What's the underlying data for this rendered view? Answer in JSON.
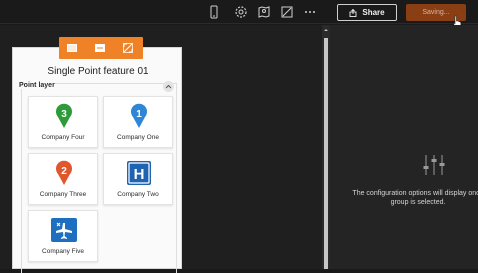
{
  "header": {
    "share_label": "Share",
    "saving_label": "Saving...",
    "icons": [
      "mobile-icon",
      "gear-icon",
      "map-settings-icon",
      "image-edit-icon",
      "more-icon"
    ]
  },
  "card": {
    "title": "Single Point feature 01",
    "section_label": "Point layer",
    "items": [
      {
        "label": "Company Four",
        "icon": "green-pin-3",
        "badge": "3",
        "color": "#2e9b3a"
      },
      {
        "label": "Company One",
        "icon": "blue-pin-1",
        "badge": "1",
        "color": "#2f86d6"
      },
      {
        "label": "Company Three",
        "icon": "red-pin-2",
        "badge": "2",
        "color": "#e0572c"
      },
      {
        "label": "Company Two",
        "icon": "hospital-h",
        "badge": "H",
        "color": "#1f64b0"
      },
      {
        "label": "Company Five",
        "icon": "airport-plane",
        "badge": "",
        "color": "#1f6fc0"
      }
    ]
  },
  "panel": {
    "message_line1": "The configuration options will display once",
    "message_line2": "group is selected."
  },
  "colors": {
    "accent": "#ef8127",
    "saving_bg": "#8a3e14"
  }
}
